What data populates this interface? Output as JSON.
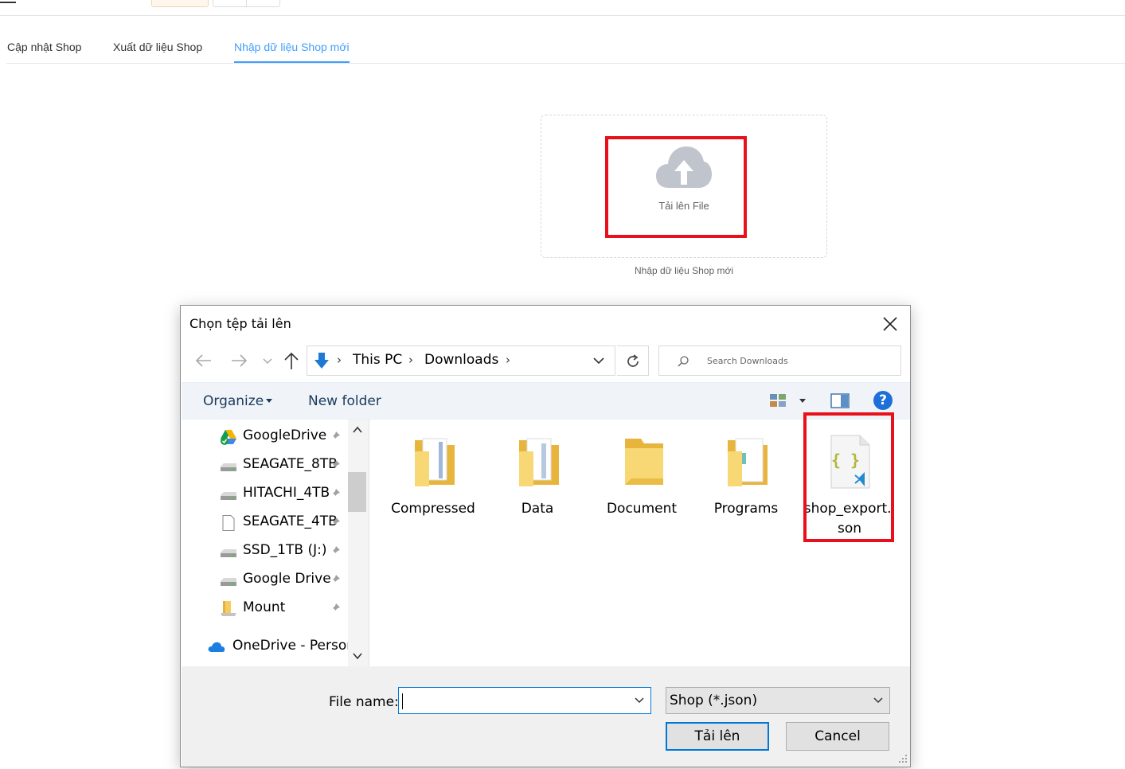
{
  "page": {
    "tabs": [
      {
        "label": "Cập nhật Shop"
      },
      {
        "label": "Xuất dữ liệu Shop"
      },
      {
        "label": "Nhập dữ liệu Shop mới"
      }
    ],
    "active_tab": "Nhập dữ liệu Shop mới",
    "upload": {
      "button_label": "Tải lên File",
      "hint": "Nhập dữ liệu Shop mới"
    },
    "accent_color": "#409eff",
    "highlight_color": "#e8101a"
  },
  "dialog": {
    "title": "Chọn tệp tải lên",
    "address": {
      "parts": [
        "This PC",
        "Downloads"
      ]
    },
    "search_placeholder": "Search Downloads",
    "toolbar": {
      "organize_label": "Organize",
      "new_folder_label": "New folder"
    },
    "nav_items": [
      {
        "label": "GoogleDrive",
        "icon": "google-drive-icon",
        "pinned": true
      },
      {
        "label": "SEAGATE_8TB",
        "icon": "drive-icon",
        "pinned": true
      },
      {
        "label": "HITACHI_4TB",
        "icon": "drive-icon",
        "pinned": true
      },
      {
        "label": "SEAGATE_4TB",
        "icon": "document-icon",
        "pinned": true
      },
      {
        "label": "SSD_1TB (J:)",
        "icon": "drive-icon",
        "pinned": true
      },
      {
        "label": "Google Drive",
        "icon": "drive-icon",
        "pinned": true
      },
      {
        "label": "Mount",
        "icon": "folder-icon",
        "pinned": true
      },
      {
        "label": "OneDrive - Person",
        "icon": "onedrive-icon",
        "pinned": false
      }
    ],
    "files": [
      {
        "name": "Compressed",
        "type": "folder"
      },
      {
        "name": "Data",
        "type": "folder"
      },
      {
        "name": "Document",
        "type": "folder"
      },
      {
        "name": "Programs",
        "type": "folder"
      },
      {
        "name": "shop_export.json",
        "type": "json"
      }
    ],
    "file_name_label": "File name:",
    "file_name_value": "",
    "file_type_label": "Shop (*.json)",
    "open_label": "Tải lên",
    "cancel_label": "Cancel"
  }
}
